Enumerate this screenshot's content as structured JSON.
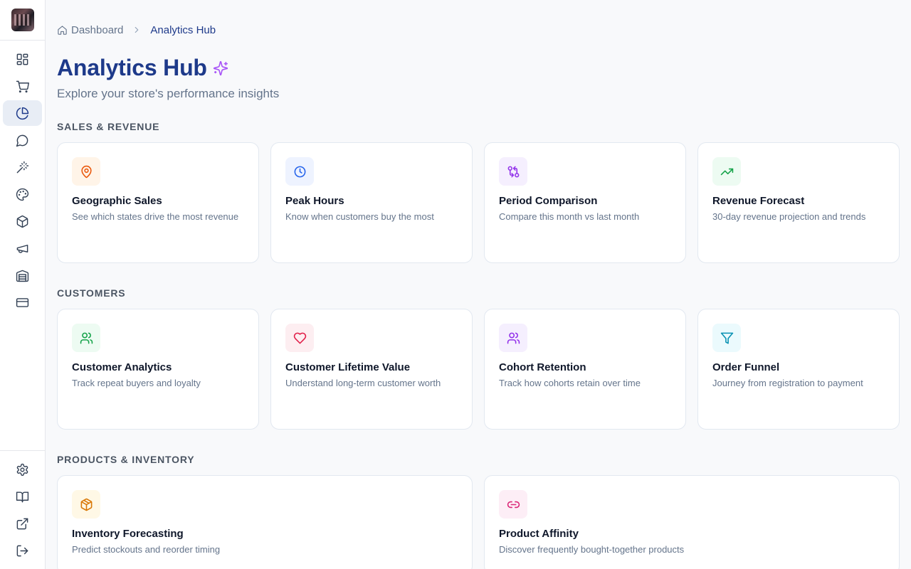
{
  "sidebar": {
    "nav": [
      {
        "icon": "dashboard-icon"
      },
      {
        "icon": "cart-icon"
      },
      {
        "icon": "analytics-pie-icon",
        "active": true
      },
      {
        "icon": "chat-icon"
      },
      {
        "icon": "magic-wand-icon"
      },
      {
        "icon": "palette-icon"
      },
      {
        "icon": "package-icon"
      },
      {
        "icon": "megaphone-icon"
      },
      {
        "icon": "warehouse-icon"
      },
      {
        "icon": "credit-card-icon"
      }
    ],
    "bottom": [
      {
        "icon": "settings-icon"
      },
      {
        "icon": "book-icon"
      },
      {
        "icon": "external-link-icon"
      },
      {
        "icon": "logout-icon"
      }
    ]
  },
  "breadcrumb": {
    "home": "Dashboard",
    "current": "Analytics Hub"
  },
  "header": {
    "title": "Analytics Hub",
    "subtitle": "Explore your store's performance insights"
  },
  "sections": [
    {
      "label": "SALES & REVENUE",
      "cards": [
        {
          "title": "Geographic Sales",
          "desc": "See which states drive the most revenue",
          "icon": "map-pin-icon",
          "color": "#ea580c",
          "bg": "#fff4e8"
        },
        {
          "title": "Peak Hours",
          "desc": "Know when customers buy the most",
          "icon": "clock-icon",
          "color": "#2563eb",
          "bg": "#eef3ff"
        },
        {
          "title": "Period Comparison",
          "desc": "Compare this month vs last month",
          "icon": "compare-arrows-icon",
          "color": "#9333ea",
          "bg": "#f5effe"
        },
        {
          "title": "Revenue Forecast",
          "desc": "30-day revenue projection and trends",
          "icon": "trending-up-icon",
          "color": "#16a34a",
          "bg": "#edfbf2"
        }
      ]
    },
    {
      "label": "CUSTOMERS",
      "cards": [
        {
          "title": "Customer Analytics",
          "desc": "Track repeat buyers and loyalty",
          "icon": "users-icon",
          "color": "#16a34a",
          "bg": "#edfbf2"
        },
        {
          "title": "Customer Lifetime Value",
          "desc": "Understand long-term customer worth",
          "icon": "heart-icon",
          "color": "#e11d48",
          "bg": "#fdeef1"
        },
        {
          "title": "Cohort Retention",
          "desc": "Track how cohorts retain over time",
          "icon": "users-icon",
          "color": "#9333ea",
          "bg": "#f5effe"
        },
        {
          "title": "Order Funnel",
          "desc": "Journey from registration to payment",
          "icon": "funnel-icon",
          "color": "#0891b2",
          "bg": "#ebfafd"
        }
      ]
    },
    {
      "label": "PRODUCTS & INVENTORY",
      "cards": [
        {
          "title": "Inventory Forecasting",
          "desc": "Predict stockouts and reorder timing",
          "icon": "package-icon",
          "color": "#d97706",
          "bg": "#fff8e6"
        },
        {
          "title": "Product Affinity",
          "desc": "Discover frequently bought-together products",
          "icon": "link-icon",
          "color": "#db2777",
          "bg": "#fdeef6"
        }
      ]
    }
  ]
}
